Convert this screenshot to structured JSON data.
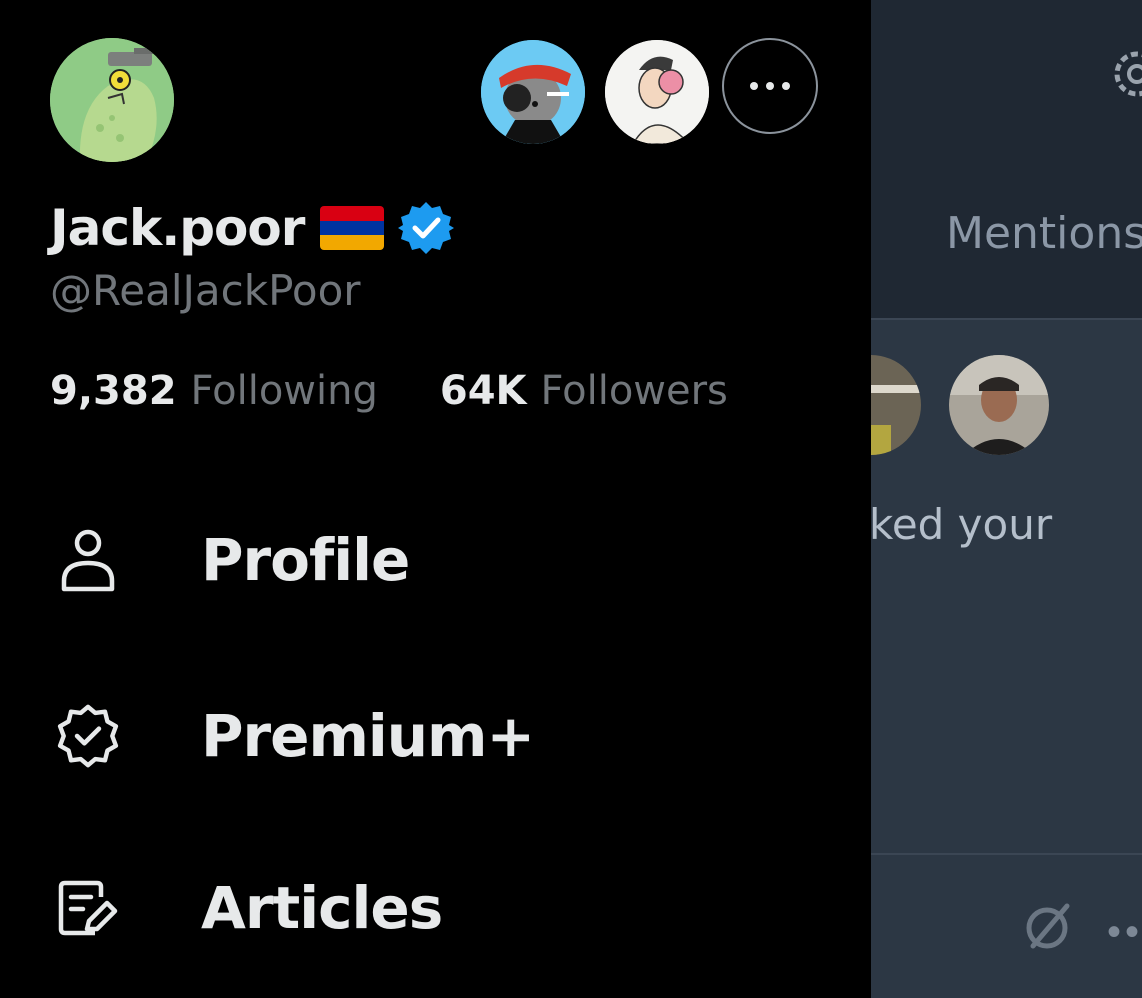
{
  "account": {
    "display_name": "Jack.poor",
    "handle": "@RealJackPoor",
    "verified": true,
    "flag_colors": [
      "#d90012",
      "#0033a0",
      "#f2a800"
    ],
    "verified_color": "#1d9bf0"
  },
  "stats": {
    "following_count": "9,382",
    "following_label": "Following",
    "followers_count": "64K",
    "followers_label": "Followers"
  },
  "menu": {
    "items": [
      {
        "label": "Profile",
        "icon": "person-icon"
      },
      {
        "label": "Premium+",
        "icon": "verified-outline-icon"
      },
      {
        "label": "Articles",
        "icon": "article-edit-icon"
      }
    ]
  },
  "background": {
    "tab_label": "Mentions",
    "notification_snippet": "ked your"
  }
}
